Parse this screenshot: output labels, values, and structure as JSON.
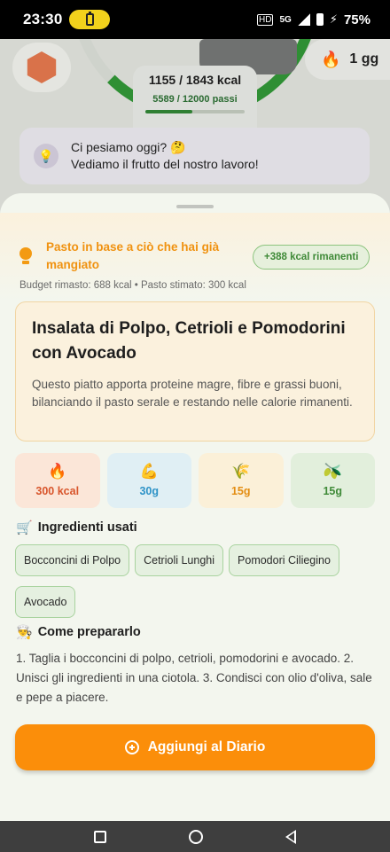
{
  "status_bar": {
    "time": "23:30",
    "battery_pct": "75%",
    "network": "5G"
  },
  "background": {
    "kcal": "1155 / 1843 kcal",
    "steps": "5589 / 12000 passi",
    "steps_progress": 0.47,
    "weight_badge": "1 gg",
    "weigh_prompt_line1": "Ci pesiamo oggi? 🤔",
    "weigh_prompt_line2": "Vediamo il frutto del nostro lavoro!"
  },
  "sheet": {
    "banner_title": "Pasto in base a ciò che hai già mangiato",
    "remaining_badge": "+388 kcal rimanenti",
    "budget_text": "Budget rimasto: 688 kcal  •  Pasto stimato: 300 kcal",
    "dish_name": "Insalata di Polpo, Cetrioli e Pomodorini con Avocado",
    "dish_description": "Questo piatto apporta proteine magre, fibre e grassi buoni, bilanciando il pasto serale e restando nelle calorie rimanenti.",
    "macros": [
      {
        "icon": "🔥",
        "value": "300 kcal"
      },
      {
        "icon": "💪",
        "value": "30g"
      },
      {
        "icon": "🌾",
        "value": "15g"
      },
      {
        "icon": "🫒",
        "value": "15g"
      }
    ],
    "ingredients_title": "Ingredienti usati",
    "ingredients_icon": "🛒",
    "ingredients": [
      "Bocconcini di Polpo",
      "Cetrioli Lunghi",
      "Pomodori Ciliegino",
      "Avocado"
    ],
    "prep_title": "Come prepararlo",
    "prep_icon": "👨‍🍳",
    "prep_text": "1. Taglia i bocconcini di polpo, cetrioli, pomodorini e avocado. 2. Unisci gli ingredienti in una ciotola. 3. Condisci con olio d'oliva, sale e pepe a piacere.",
    "cta_label": "Aggiungi al Diario"
  },
  "colors": {
    "accent_orange": "#fb8e0a",
    "green": "#3f8a38",
    "sheet_bg": "#f3f6ee"
  }
}
